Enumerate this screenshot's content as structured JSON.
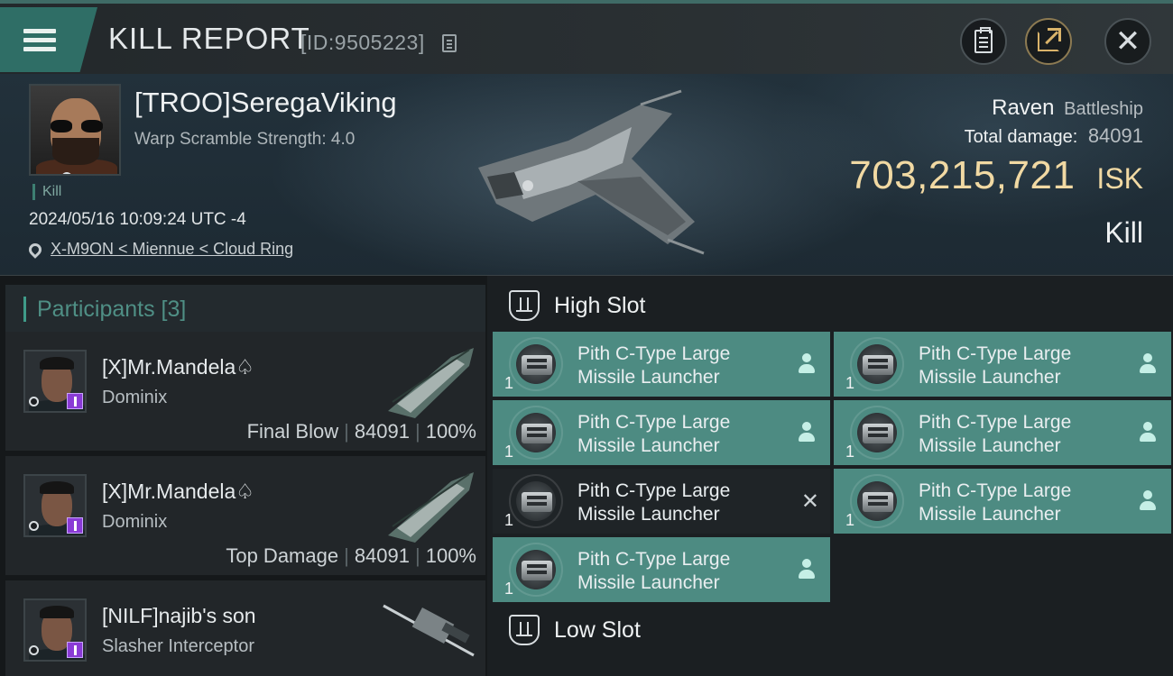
{
  "header": {
    "title": "KILL REPORT",
    "id_text": "[ID:9505223]",
    "menu_icon": "hamburger-menu-icon",
    "buttons": [
      "clipboard-icon",
      "share-icon",
      "close-icon"
    ]
  },
  "victim": {
    "name": "[TROO]SeregaViking",
    "warp_scramble": "Warp Scramble Strength: 4.0",
    "tag": "Kill",
    "datetime": "2024/05/16 10:09:24 UTC -4",
    "location": "X-M9ON < Miennue < Cloud Ring",
    "ship_name": "Raven",
    "ship_class": "Battleship",
    "total_damage_label": "Total damage:",
    "total_damage": "84091",
    "isk_value": "703,215,721",
    "isk_unit": "ISK",
    "result": "Kill"
  },
  "participants": {
    "title": "Participants [3]",
    "items": [
      {
        "name": "[X]Mr.Mandela♤",
        "ship": "Dominix",
        "role": "Final Blow",
        "damage": "84091",
        "percent": "100%"
      },
      {
        "name": "[X]Mr.Mandela♤",
        "ship": "Dominix",
        "role": "Top Damage",
        "damage": "84091",
        "percent": "100%"
      },
      {
        "name": "[NILF]najib's son",
        "ship": "Slasher Interceptor",
        "role": "",
        "damage": "",
        "percent": ""
      }
    ]
  },
  "slots": {
    "high_label": "High Slot",
    "low_label": "Low Slot",
    "modules": [
      {
        "line1": "Pith C-Type Large",
        "line2": "Missile Launcher",
        "qty": "1",
        "state": "dropped"
      },
      {
        "line1": "Pith C-Type Large",
        "line2": "Missile Launcher",
        "qty": "1",
        "state": "dropped"
      },
      {
        "line1": "Pith C-Type Large",
        "line2": "Missile Launcher",
        "qty": "1",
        "state": "dropped"
      },
      {
        "line1": "Pith C-Type Large",
        "line2": "Missile Launcher",
        "qty": "1",
        "state": "dropped"
      },
      {
        "line1": "Pith C-Type Large",
        "line2": "Missile Launcher",
        "qty": "1",
        "state": "destroyed"
      },
      {
        "line1": "Pith C-Type Large",
        "line2": "Missile Launcher",
        "qty": "1",
        "state": "dropped"
      },
      {
        "line1": "Pith C-Type Large",
        "line2": "Missile Launcher",
        "qty": "1",
        "state": "dropped"
      }
    ]
  },
  "colors": {
    "accent_teal": "#4d8b82",
    "isk_gold": "#f1d9a3",
    "header_bg": "#23282b"
  }
}
